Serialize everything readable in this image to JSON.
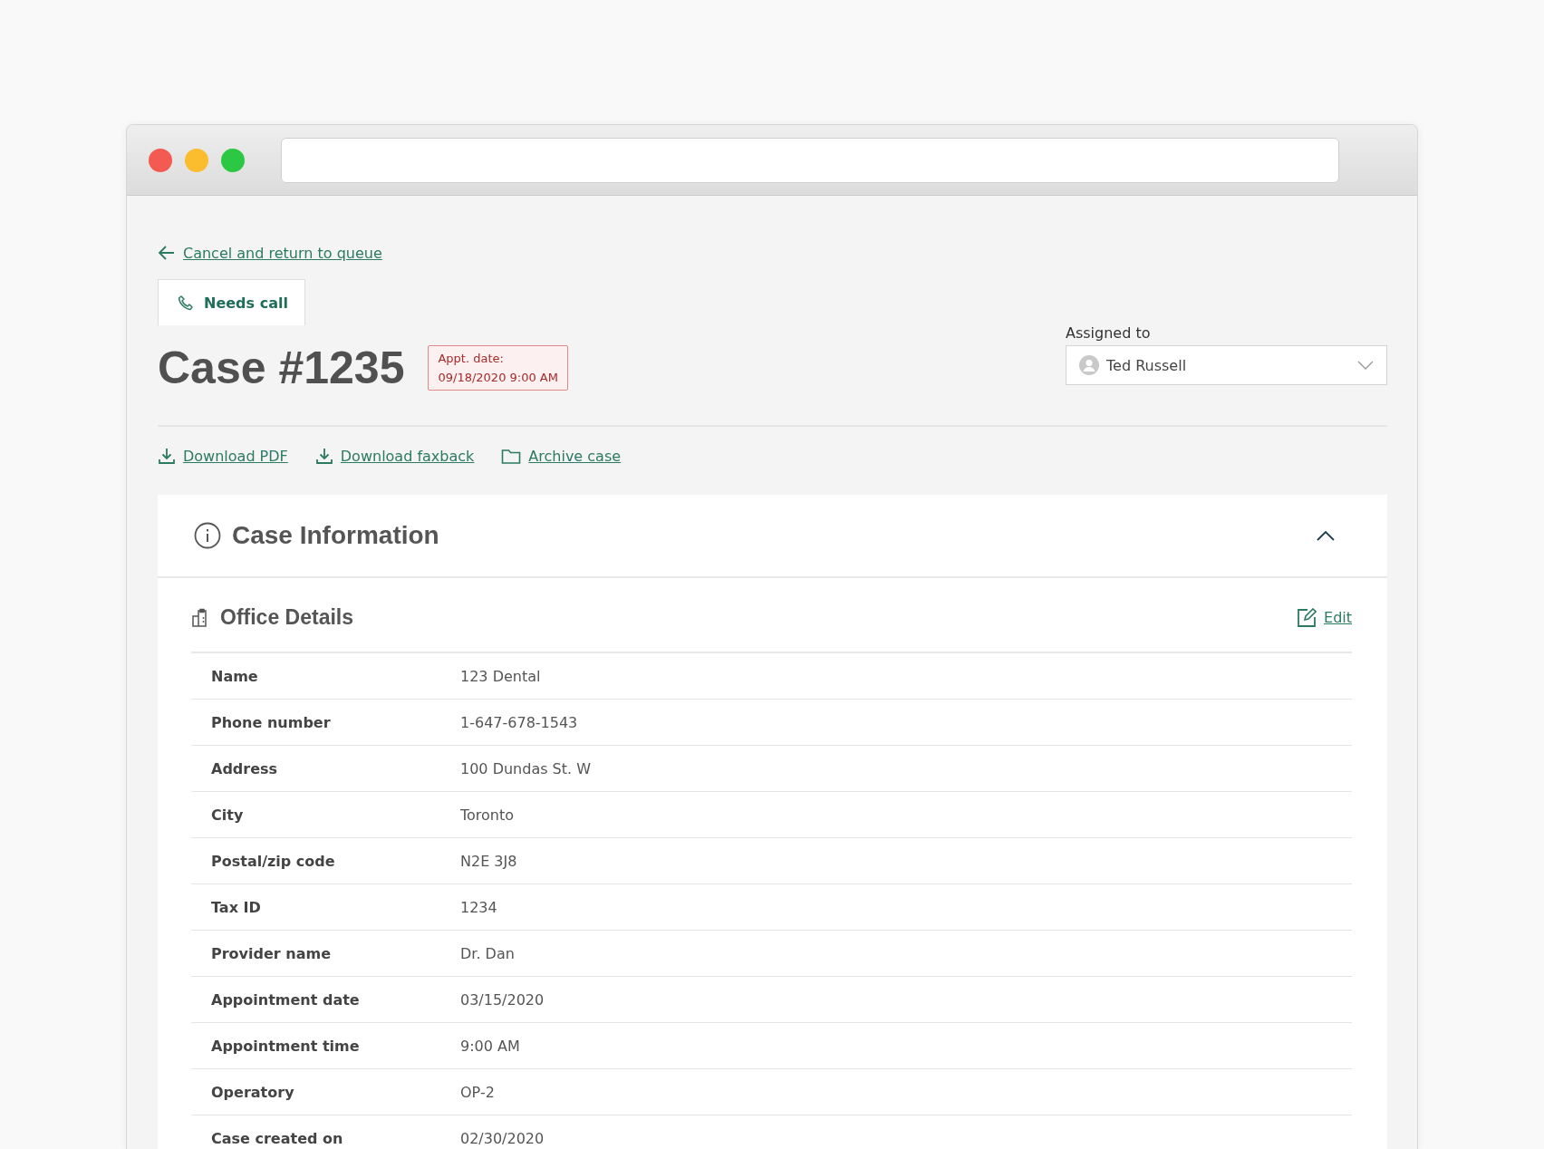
{
  "back_link": "Cancel and return to queue",
  "status_tab": {
    "label": "Needs call"
  },
  "case_title": "Case #1235",
  "appointment_badge": {
    "label": "Appt. date:",
    "value": "09/18/2020 9:00 AM"
  },
  "assignee": {
    "label": "Assigned to",
    "value": "Ted Russell"
  },
  "actions": [
    {
      "kind": "download",
      "label": "Download PDF"
    },
    {
      "kind": "download",
      "label": "Download faxback"
    },
    {
      "kind": "archive",
      "label": "Archive case"
    }
  ],
  "section": {
    "title": "Case Information",
    "expanded": true,
    "subsection": {
      "title": "Office Details",
      "edit_link": "Edit",
      "rows": [
        {
          "label": "Name",
          "value": "123 Dental"
        },
        {
          "label": "Phone number",
          "value": "1-647-678-1543"
        },
        {
          "label": "Address",
          "value": "100 Dundas St. W"
        },
        {
          "label": "City",
          "value": "Toronto"
        },
        {
          "label": "Postal/zip code",
          "value": "N2E 3J8"
        },
        {
          "label": "Tax ID",
          "value": "1234"
        },
        {
          "label": "Provider name",
          "value": "Dr. Dan"
        },
        {
          "label": "Appointment date",
          "value": "03/15/2020"
        },
        {
          "label": "Appointment time",
          "value": "9:00 AM"
        },
        {
          "label": "Operatory",
          "value": "OP-2"
        },
        {
          "label": "Case created on",
          "value": "02/30/2020"
        }
      ]
    }
  }
}
